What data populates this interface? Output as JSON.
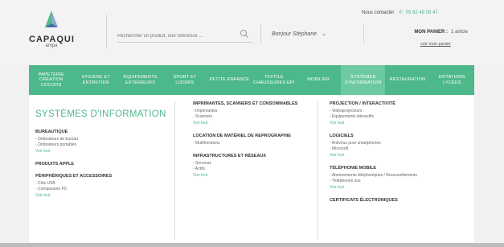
{
  "header": {
    "logo": {
      "name": "CAPAQUI",
      "sub": "ampa"
    },
    "search": {
      "placeholder": "Rechercher un produit, une référence ..."
    },
    "greeting": "Bonjour Stéphane",
    "contact": {
      "label": "Nous contacter",
      "phone": "05 82 48 08 47"
    },
    "cart": {
      "title": "MON PANIER :",
      "count": "1 article",
      "link": "voir mon panier"
    }
  },
  "nav": [
    "PAPETERIE CRÉATION COCOOS",
    "HYGIÈNE ET ENTRETIEN",
    "ÉQUIPEMENTS EXTÉRIEURS",
    "SPORT ET LOISIRS",
    "PETITE ENFANCE",
    "TEXTILE CHAUSSURES EPI",
    "MOBILIER",
    "SYSTÈMES D'INFORMATION",
    "RESTAURATION",
    "DOTATIONS LYCÉES"
  ],
  "panel": {
    "title": "SYSTÈMES D'INFORMATION",
    "col1": [
      {
        "title": "BUREAUTIQUE",
        "items": [
          "Ordinateurs de bureau",
          "Ordinateurs portables"
        ],
        "more": "Voir tout"
      },
      {
        "title": "PRODUITS APPLE",
        "items": [],
        "more": ""
      },
      {
        "title": "PÉRIPHÉRIQUES ET ACCESSOIRES",
        "items": [
          "Clés USB",
          "Composants PC"
        ],
        "more": "Voir tout"
      }
    ],
    "col2": [
      {
        "title": "IMPRIMANTES, SCANNERS ET CONSOMMABLES",
        "items": [
          "Imprimantes",
          "Scanners"
        ],
        "more": "Voir tout"
      },
      {
        "title": "LOCATION DE MATÉRIEL DE REPROGRAPHIE",
        "items": [
          "Multifonctions"
        ],
        "more": ""
      },
      {
        "title": "INFRASTRUCTURES ET RÉSEAUX",
        "items": [
          "Serveurs",
          "Actifs"
        ],
        "more": "Voir tout"
      }
    ],
    "col3": [
      {
        "title": "PROJECTION / INTERACTIVITÉ",
        "items": [
          "Vidéoprojecteurs",
          "Équipements interactifs"
        ],
        "more": "Voir tout"
      },
      {
        "title": "LOGICIELS",
        "items": [
          "Antivirus pour smartphones",
          "Microsoft"
        ],
        "more": "Voir tout"
      },
      {
        "title": "TÉLÉPHONIE MOBILE",
        "items": [
          "Abonnements téléphoniques / Renouvellements",
          "Téléphones nus"
        ],
        "more": "Voir tout"
      },
      {
        "title": "CERTIFICATS ÉLECTRONIQUES",
        "items": [],
        "more": ""
      }
    ]
  },
  "colors": {
    "accent": "#4db88a",
    "accent_light": "#6cc9a0"
  },
  "nav_active_index": 7
}
